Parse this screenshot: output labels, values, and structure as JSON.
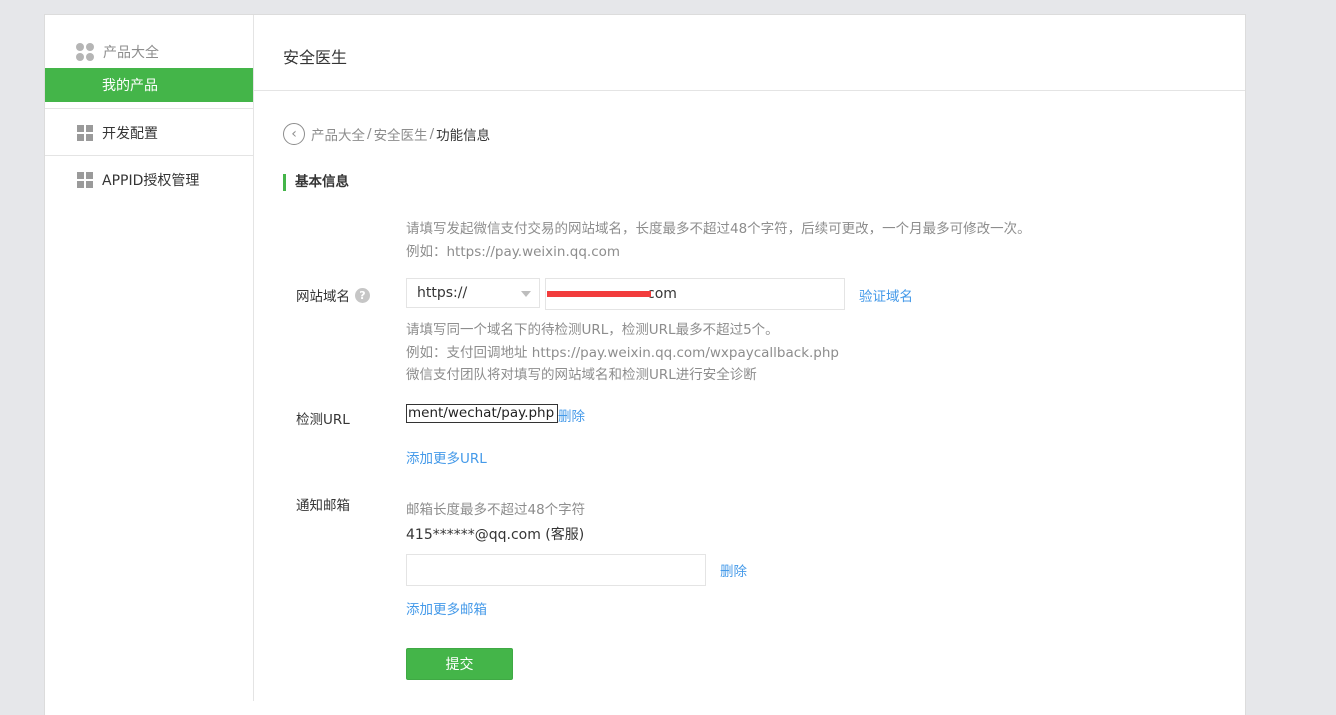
{
  "sidebar": {
    "groups": [
      {
        "label": "产品大全",
        "icon": "clover-icon"
      },
      {
        "label": "开发配置",
        "icon": "grid-icon"
      },
      {
        "label": "APPID授权管理",
        "icon": "grid-icon"
      }
    ],
    "active_item": "我的产品"
  },
  "main": {
    "title": "安全医生",
    "breadcrumb": {
      "items": [
        "产品大全",
        "安全医生"
      ],
      "current": "功能信息",
      "separator": "/"
    },
    "section_title": "基本信息"
  },
  "domain": {
    "hint_line1": "请填写发起微信支付交易的网站域名，长度最多不超过48个字符，后续可更改，一个月最多可修改一次。",
    "hint_line2": "例如：https://pay.weixin.qq.com",
    "label": "网站域名",
    "help_symbol": "?",
    "protocol": "https://",
    "value_visible": "com",
    "verify_link": "验证域名"
  },
  "detect_url": {
    "hint_line1": "请填写同一个域名下的待检测URL，检测URL最多不超过5个。",
    "hint_line2": "例如：支付回调地址 https://pay.weixin.qq.com/wxpaycallback.php",
    "hint_line3": "微信支付团队将对填写的网站域名和检测URL进行安全诊断",
    "label": "检测URL",
    "value": "ment/wechat/pay.php",
    "delete_link": "删除",
    "add_more": "添加更多URL"
  },
  "notify_email": {
    "label": "通知邮箱",
    "hint": "邮箱长度最多不超过48个字符",
    "existing": "415******@qq.com (客服)",
    "input_value": "",
    "delete_link": "删除",
    "add_more": "添加更多邮箱"
  },
  "submit_label": "提交",
  "colors": {
    "accent": "#44b549",
    "link": "#459ae9",
    "muted": "#8d8d8d",
    "redaction": "#f23c3c"
  }
}
